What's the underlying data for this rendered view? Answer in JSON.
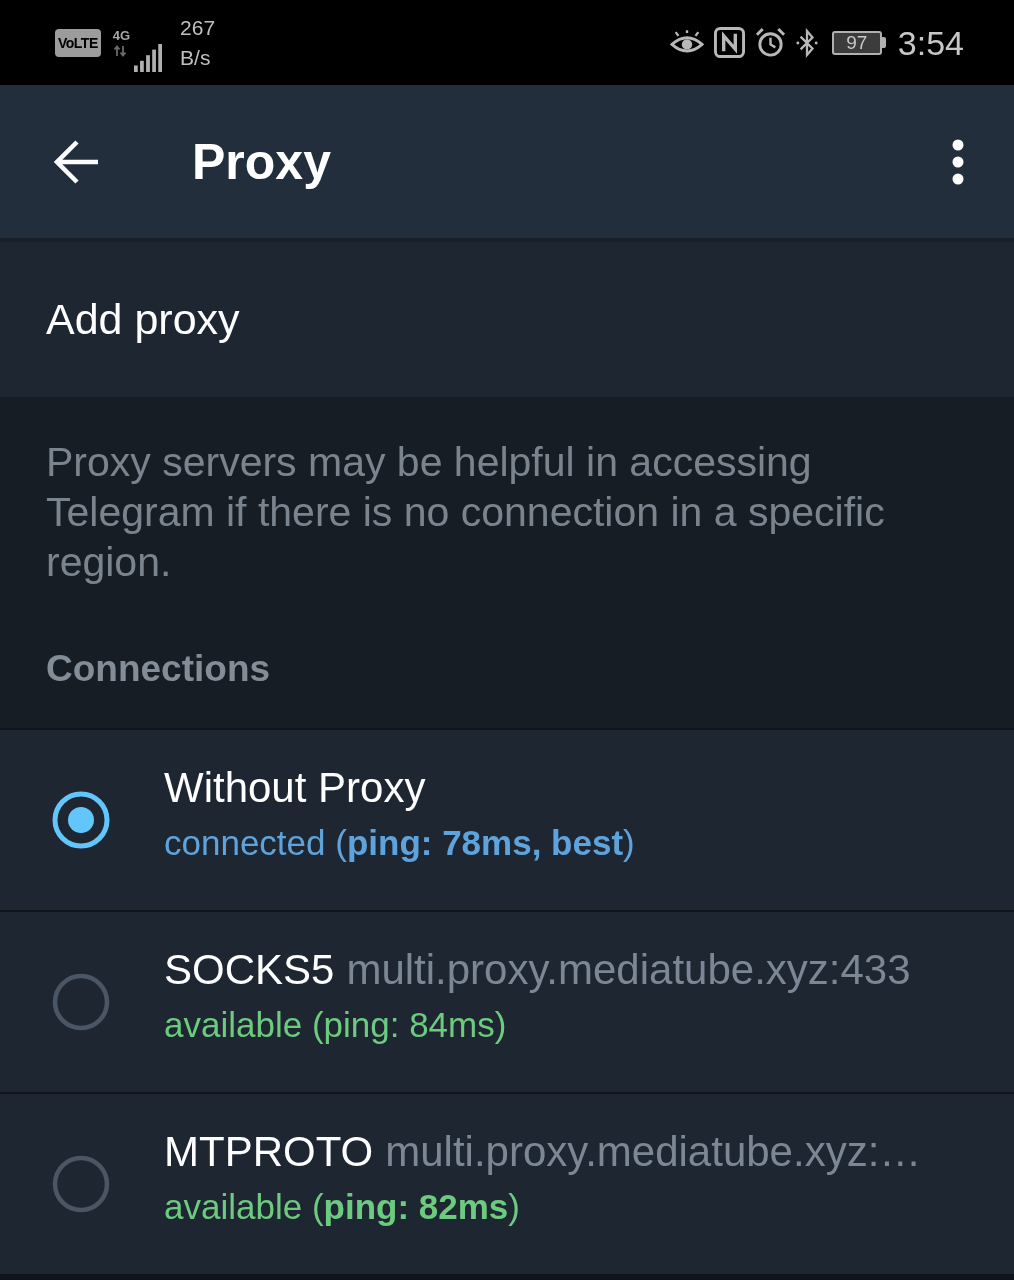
{
  "status_bar": {
    "volte": "VoLTE",
    "network": "4G",
    "speed_value": "267",
    "speed_unit": "B/s",
    "battery": "97",
    "time": "3:54"
  },
  "app_bar": {
    "title": "Proxy"
  },
  "add_proxy": {
    "label": "Add proxy"
  },
  "info": {
    "text": "Proxy servers may be helpful in accessing Telegram if there is no connection in a specific region.",
    "section_header": "Connections"
  },
  "connections": [
    {
      "name": "Without Proxy",
      "status": "connected (**ping: 78ms, best**)",
      "color": "#5fa3dc",
      "selected": true
    },
    {
      "name": "SOCKS5",
      "host": "multi.proxy.mediatube.xyz:433",
      "status": "available (ping: 84ms)",
      "color": "#6ccb7e",
      "selected": false
    },
    {
      "name": "MTPROTO",
      "host": "multi.proxy.mediatube.xyz:…",
      "status": "available (**ping: 82ms**)",
      "color": "#6ccb7e",
      "selected": false
    }
  ]
}
